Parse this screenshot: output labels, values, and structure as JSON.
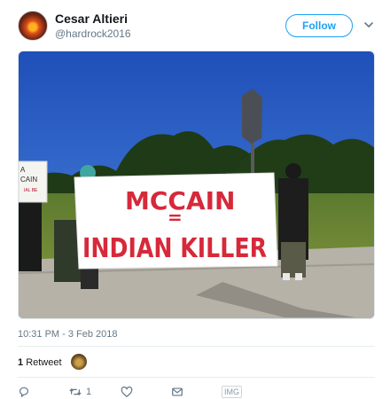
{
  "user": {
    "display_name": "Cesar Altieri",
    "handle": "@hardrock2016"
  },
  "header": {
    "follow_label": "Follow"
  },
  "photo": {
    "banner_line1": "MCCAIN",
    "banner_line2": "=",
    "banner_line3": "INDIAN KILLER",
    "small_sign_line1": "A",
    "small_sign_line2": "CAIN",
    "small_sign_line3": "IAL BE"
  },
  "meta": {
    "timestamp": "10:31 PM - 3 Feb 2018",
    "retweet_count": "1",
    "retweet_label": "Retweet"
  },
  "actions": {
    "reply_icon": "reply-icon",
    "retweet_icon": "retweet-icon",
    "retweet_count": "1",
    "like_icon": "like-icon",
    "dm_icon": "direct-message-icon",
    "img_badge": "IMG"
  },
  "colors": {
    "accent": "#1da1f2",
    "muted": "#657786",
    "banner_text": "#d6293a"
  }
}
